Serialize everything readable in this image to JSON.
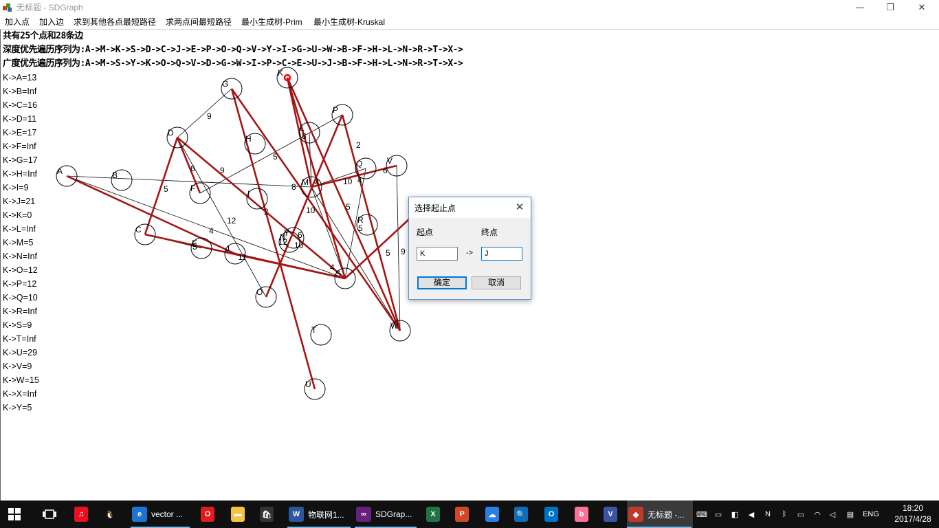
{
  "window": {
    "title": "无标题 - SDGraph",
    "min_glyph": "—",
    "restore_glyph": "❐",
    "close_glyph": "✕"
  },
  "menu": [
    "加入点",
    "加入边",
    "求到其他各点最短路径",
    "求两点间最短路径",
    "最小生成树-Prim",
    "最小生成树-Kruskal"
  ],
  "info": {
    "summary": "共有25个点和28条边",
    "dfs": "深度优先遍历序列为:A->M->K->S->D->C->J->E->P->O->Q->V->Y->I->G->U->W->B->F->H->L->N->R->T->X->",
    "bfs": "广度优先遍历序列为:A->M->S->Y->K->O->Q->V->D->G->W->I->P->C->E->U->J->B->F->H->L->N->R->T->X->"
  },
  "distances": [
    "K->A=13",
    "K->B=Inf",
    "K->C=16",
    "K->D=11",
    "K->E=17",
    "K->F=Inf",
    "K->G=17",
    "K->H=Inf",
    "K->I=9",
    "K->J=21",
    "K->K=0",
    "K->L=Inf",
    "K->M=5",
    "K->N=Inf",
    "K->O=12",
    "K->P=12",
    "K->Q=10",
    "K->R=Inf",
    "K->S=9",
    "K->T=Inf",
    "K->U=29",
    "K->V=9",
    "K->W=15",
    "K->X=Inf",
    "K->Y=5"
  ],
  "graph": {
    "colors": {
      "edge": "#000000",
      "path": "#a31515",
      "node_stroke": "#000000",
      "source": "#ff0000"
    },
    "nodes": [
      {
        "id": "A"
      },
      {
        "id": "B"
      },
      {
        "id": "C"
      },
      {
        "id": "D"
      },
      {
        "id": "E"
      },
      {
        "id": "F"
      },
      {
        "id": "G"
      },
      {
        "id": "H"
      },
      {
        "id": "I"
      },
      {
        "id": "J"
      },
      {
        "id": "K"
      },
      {
        "id": "L"
      },
      {
        "id": "M"
      },
      {
        "id": "N"
      },
      {
        "id": "O"
      },
      {
        "id": "P"
      },
      {
        "id": "Q"
      },
      {
        "id": "R"
      },
      {
        "id": "S"
      },
      {
        "id": "T"
      },
      {
        "id": "U"
      },
      {
        "id": "V"
      },
      {
        "id": "W"
      },
      {
        "id": "X"
      },
      {
        "id": "Y"
      }
    ],
    "weights": [
      "9",
      "5",
      "6",
      "9",
      "5",
      "8",
      "2",
      "4",
      "6",
      "10",
      "4",
      "12",
      "2",
      "8",
      "5",
      "4",
      "5",
      "5",
      "12",
      "10",
      "10",
      "5",
      "9",
      "11",
      "4",
      "6"
    ]
  },
  "dialog": {
    "title": "选择起止点",
    "close_glyph": "✕",
    "start_label": "起点",
    "end_label": "终点",
    "arrow": "->",
    "start_value": "K",
    "end_value": "J",
    "ok": "确定",
    "cancel": "取消"
  },
  "taskbar": {
    "start_icon": "windows-icon",
    "apps": [
      {
        "name": "netease-music",
        "label": ""
      },
      {
        "name": "qq",
        "label": ""
      },
      {
        "name": "edge",
        "label": "vector ..."
      },
      {
        "name": "opera",
        "label": ""
      },
      {
        "name": "file-explorer",
        "label": ""
      },
      {
        "name": "store",
        "label": ""
      },
      {
        "name": "word",
        "label": "物联网1..."
      },
      {
        "name": "visual-studio",
        "label": "SDGrap..."
      },
      {
        "name": "excel",
        "label": ""
      },
      {
        "name": "powerpoint",
        "label": ""
      },
      {
        "name": "baidu-netdisk",
        "label": ""
      },
      {
        "name": "search-app",
        "label": ""
      },
      {
        "name": "outlook",
        "label": ""
      },
      {
        "name": "bilibili",
        "label": ""
      },
      {
        "name": "visio",
        "label": ""
      },
      {
        "name": "sdgraph",
        "label": "无标题 -..."
      }
    ],
    "tray_lang": "ENG",
    "time": "18:20",
    "date": "2017/4/28"
  }
}
